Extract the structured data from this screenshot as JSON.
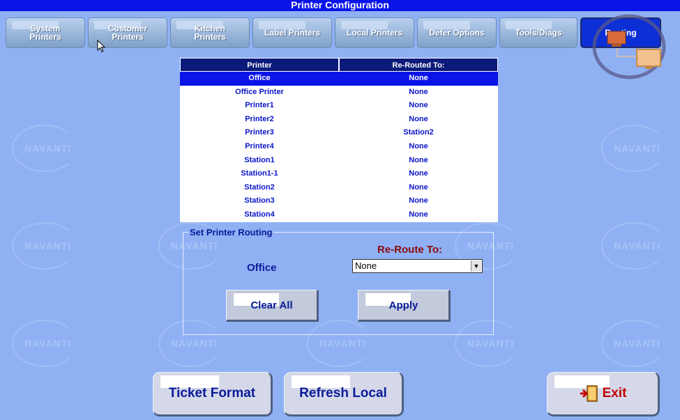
{
  "window": {
    "title": "Printer Configuration"
  },
  "tabs": [
    {
      "label": "System Printers",
      "active": false
    },
    {
      "label": "Customer Printers",
      "active": false
    },
    {
      "label": "Kitchen Printers",
      "active": false
    },
    {
      "label": "Label Printers",
      "active": false
    },
    {
      "label": "Local Printers",
      "active": false
    },
    {
      "label": "Defer Options",
      "active": false
    },
    {
      "label": "Tools/Diags",
      "active": false
    },
    {
      "label": "Routing",
      "active": true
    }
  ],
  "watermark": {
    "text": "NAVANTI"
  },
  "table": {
    "columns": [
      "Printer",
      "Re-Routed To:"
    ],
    "rows": [
      {
        "printer": "Office",
        "rerouted_to": "None",
        "selected": true
      },
      {
        "printer": "Office Printer",
        "rerouted_to": "None",
        "selected": false
      },
      {
        "printer": "Printer1",
        "rerouted_to": "None",
        "selected": false
      },
      {
        "printer": "Printer2",
        "rerouted_to": "None",
        "selected": false
      },
      {
        "printer": "Printer3",
        "rerouted_to": "Station2",
        "selected": false
      },
      {
        "printer": "Printer4",
        "rerouted_to": "None",
        "selected": false
      },
      {
        "printer": "Station1",
        "rerouted_to": "None",
        "selected": false
      },
      {
        "printer": "Station1-1",
        "rerouted_to": "None",
        "selected": false
      },
      {
        "printer": "Station2",
        "rerouted_to": "None",
        "selected": false
      },
      {
        "printer": "Station3",
        "rerouted_to": "None",
        "selected": false
      },
      {
        "printer": "Station4",
        "rerouted_to": "None",
        "selected": false
      }
    ]
  },
  "routing": {
    "group_title": "Set Printer Routing",
    "reroute_label": "Re-Route To:",
    "selected_printer": "Office",
    "reroute_value": "None",
    "clear_label": "Clear All",
    "apply_label": "Apply"
  },
  "footer": {
    "ticket_format_label": "Ticket Format",
    "refresh_local_label": "Refresh Local",
    "exit_label": "Exit"
  },
  "colors": {
    "background": "#8fb1f4",
    "title_bar": "#0a14e8",
    "selected_row": "#0a14e8",
    "header_row": "#0c1a7a",
    "text_blue": "#0a14c8",
    "reroute_label": "#8a0a0a",
    "exit_red": "#c40000"
  }
}
